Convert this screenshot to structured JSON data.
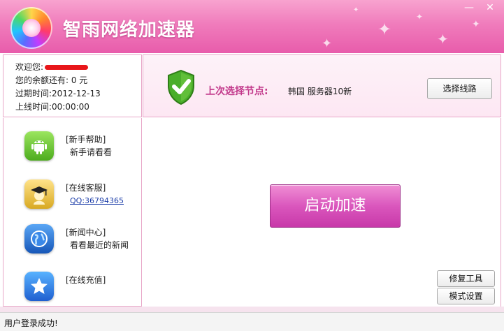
{
  "window": {
    "app_title": "智雨网络加速器",
    "controls": {
      "minimize": "—",
      "close": "✕"
    }
  },
  "user": {
    "welcome_label": "欢迎您:",
    "balance_label": "您的余额还有: 0 元",
    "expire_label": "过期时间:2012-12-13",
    "online_label": "上线时间:00:00:00"
  },
  "node": {
    "label": "上次选择节点:",
    "value": "韩国 服务器10新",
    "select_button": "选择线路"
  },
  "menu": [
    {
      "icon": "android-icon",
      "title": "[新手帮助]",
      "sub": "新手请看看"
    },
    {
      "icon": "graduate-icon",
      "title": "[在线客服]",
      "link": "QQ:36794365"
    },
    {
      "icon": "globe-icon",
      "title": "[新闻中心]",
      "sub": "看看最近的新闻"
    },
    {
      "icon": "star-icon",
      "title": "[在线充值]"
    }
  ],
  "main": {
    "start_button": "启动加速",
    "repair_button": "修复工具",
    "mode_button": "模式设置"
  },
  "status": {
    "text": "用户登录成功!"
  },
  "colors": {
    "header_pink": "#e85cab",
    "accent_magenta": "#c2398b",
    "start_button": "#da57bd",
    "link_blue": "#1a3ca8"
  }
}
